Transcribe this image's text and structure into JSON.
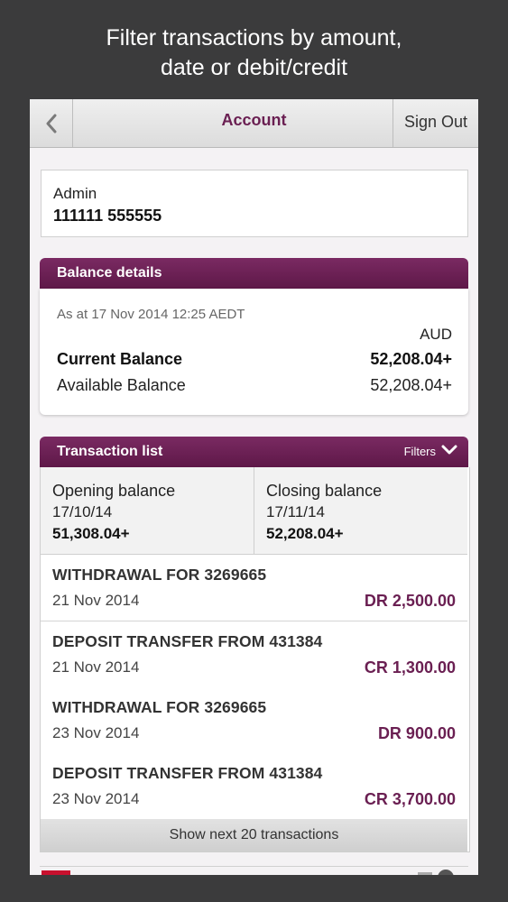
{
  "caption": {
    "line1": "Filter transactions by amount,",
    "line2": "date or debit/credit"
  },
  "navbar": {
    "back_icon": "chevron-left-icon",
    "title": "Account",
    "sign_out": "Sign Out"
  },
  "account": {
    "name": "Admin",
    "number": "111111 555555"
  },
  "balance": {
    "header": "Balance details",
    "as_at": "As at 17 Nov 2014 12:25 AEDT",
    "currency": "AUD",
    "current_label": "Current Balance",
    "current_value": "52,208.04+",
    "available_label": "Available Balance",
    "available_value": "52,208.04+"
  },
  "transactions": {
    "header": "Transaction list",
    "filters_label": "Filters",
    "opening": {
      "label": "Opening balance",
      "date": "17/10/14",
      "amount": "51,308.04+"
    },
    "closing": {
      "label": "Closing balance",
      "date": "17/11/14",
      "amount": "52,208.04+"
    },
    "items": [
      {
        "description": "WITHDRAWAL FOR 3269665",
        "date": "21 Nov 2014",
        "amount": "DR 2,500.00"
      },
      {
        "description": "DEPOSIT TRANSFER FROM 431384",
        "date": "21 Nov 2014",
        "amount": "CR 1,300.00"
      },
      {
        "description": "WITHDRAWAL FOR 3269665",
        "date": "23 Nov 2014",
        "amount": "DR 900.00"
      },
      {
        "description": "DEPOSIT TRANSFER FROM 431384",
        "date": "23 Nov 2014",
        "amount": "CR 3,700.00"
      }
    ],
    "show_next": "Show next 20 transactions"
  },
  "colors": {
    "brand": "#6a1f52",
    "background": "#3b3b3c"
  }
}
